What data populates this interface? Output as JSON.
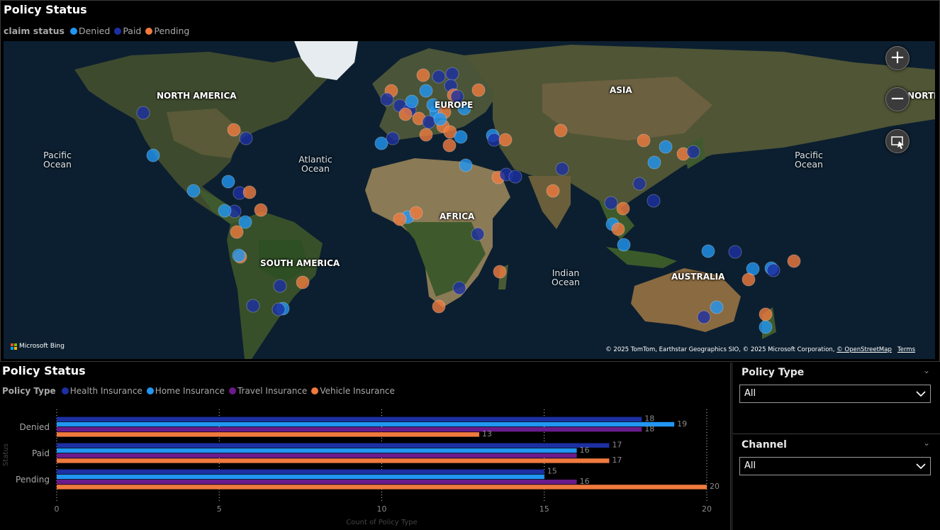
{
  "map_visual": {
    "title": "Policy Status",
    "legend_title": "claim status",
    "legend_items": [
      {
        "label": "Denied",
        "color": "#2196f3"
      },
      {
        "label": "Paid",
        "color": "#1c2fa3"
      },
      {
        "label": "Pending",
        "color": "#f07a3e"
      }
    ],
    "region_labels": [
      "NORTH AMERICA",
      "ASIA",
      "EUROPE",
      "AFRICA",
      "SOUTH AMERICA",
      "AUSTRALIA",
      "NORTH"
    ],
    "ocean_labels": [
      "Pacific Ocean",
      "Atlantic Ocean",
      "Indian Ocean",
      "Pacific Ocean"
    ],
    "zoom_in_label": "+",
    "zoom_out_label": "−",
    "bing_label": "Microsoft Bing",
    "credits": {
      "text": "© 2025 TomTom, Earthstar Geographics SIO, © 2025 Microsoft Corporation,",
      "osm": "© OpenStreetMap",
      "terms": "Terms"
    }
  },
  "bar_visual": {
    "title": "Policy Status",
    "legend_title": "Policy Type",
    "legend_items": [
      {
        "label": "Health Insurance",
        "color": "#1c2fa3"
      },
      {
        "label": "Home Insurance",
        "color": "#2196f3"
      },
      {
        "label": "Travel Insurance",
        "color": "#6a1a8a"
      },
      {
        "label": "Vehicle Insurance",
        "color": "#f07a3e"
      }
    ]
  },
  "chart_data": {
    "type": "bar",
    "orientation": "horizontal",
    "categories": [
      "Denied",
      "Paid",
      "Pending"
    ],
    "series": [
      {
        "name": "Health Insurance",
        "color": "#1c2fa3",
        "values": [
          18,
          17,
          15
        ]
      },
      {
        "name": "Home Insurance",
        "color": "#2196f3",
        "values": [
          19,
          16,
          15
        ]
      },
      {
        "name": "Travel Insurance",
        "color": "#6a1a8a",
        "values": [
          18,
          16,
          16
        ]
      },
      {
        "name": "Vehicle Insurance",
        "color": "#f07a3e",
        "values": [
          13,
          17,
          20
        ]
      }
    ],
    "data_labels": [
      [
        "18",
        "19",
        "18",
        "13"
      ],
      [
        "17",
        "16",
        "",
        "17"
      ],
      [
        "15",
        "",
        "16",
        "20"
      ]
    ],
    "xlabel": "Count of Policy Type",
    "ylabel": "Status",
    "xlim": [
      0,
      20
    ],
    "xticks": [
      "0",
      "5",
      "10",
      "15",
      "20"
    ],
    "grid": true
  },
  "slicers": [
    {
      "title": "Policy Type",
      "value": "All"
    },
    {
      "title": "Channel",
      "value": "All"
    }
  ]
}
